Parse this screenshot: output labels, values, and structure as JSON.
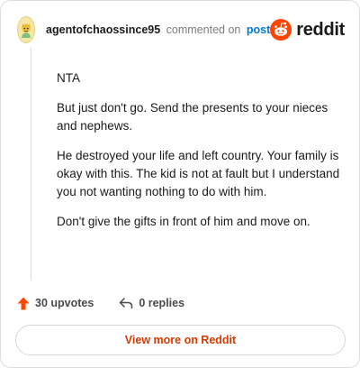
{
  "header": {
    "username": "agentofchaossince95",
    "verb": "commented on",
    "post_link": "post",
    "brand_word": "reddit"
  },
  "comment": {
    "paragraphs": [
      "NTA",
      "But just don't go. Send the presents to your nieces and nephews.",
      "He destroyed your life and left country. Your family is okay with this. The kid is not at fault but I understand you not wanting nothing to do with him.",
      "Don't give the gifts in front of him and move on."
    ]
  },
  "actions": {
    "upvotes": "30 upvotes",
    "replies": "0 replies"
  },
  "view_more_label": "View more on Reddit",
  "colors": {
    "reddit_orange": "#ff4500",
    "link_blue": "#0079d3",
    "button_text": "#d93a00"
  }
}
